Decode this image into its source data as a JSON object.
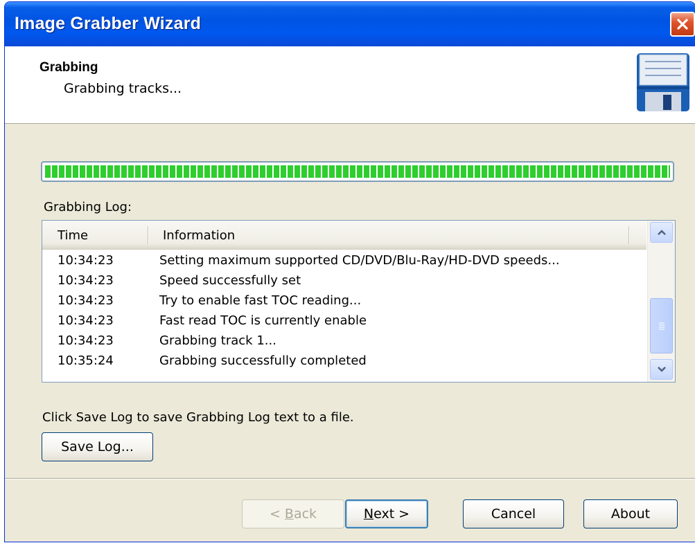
{
  "window": {
    "title": "Image Grabber Wizard"
  },
  "header": {
    "title": "Grabbing",
    "subtitle": "Grabbing tracks..."
  },
  "progress": {
    "percent": 100,
    "color": "#2ece2e"
  },
  "log": {
    "label": "Grabbing Log:",
    "columns": [
      "Time",
      "Information"
    ],
    "rows": [
      {
        "time": "10:34:23",
        "info": "Setting maximum supported CD/DVD/Blu-Ray/HD-DVD speeds..."
      },
      {
        "time": "10:34:23",
        "info": "Speed successfully set"
      },
      {
        "time": "10:34:23",
        "info": "Try to enable fast TOC reading..."
      },
      {
        "time": "10:34:23",
        "info": "Fast read TOC is currently enable"
      },
      {
        "time": "10:34:23",
        "info": "Grabbing track 1..."
      },
      {
        "time": "10:35:24",
        "info": "Grabbing successfully completed"
      }
    ]
  },
  "hint": "Click Save Log to save Grabbing Log text to a file.",
  "buttons": {
    "save_log": "Save Log...",
    "back_prefix": "< ",
    "back_key": "B",
    "back_rest": "ack",
    "next_key": "N",
    "next_rest": "ext >",
    "cancel": "Cancel",
    "about": "About"
  },
  "colors": {
    "titlebar": "#0054e3",
    "background": "#ece9d8",
    "progress": "#2ece2e"
  }
}
